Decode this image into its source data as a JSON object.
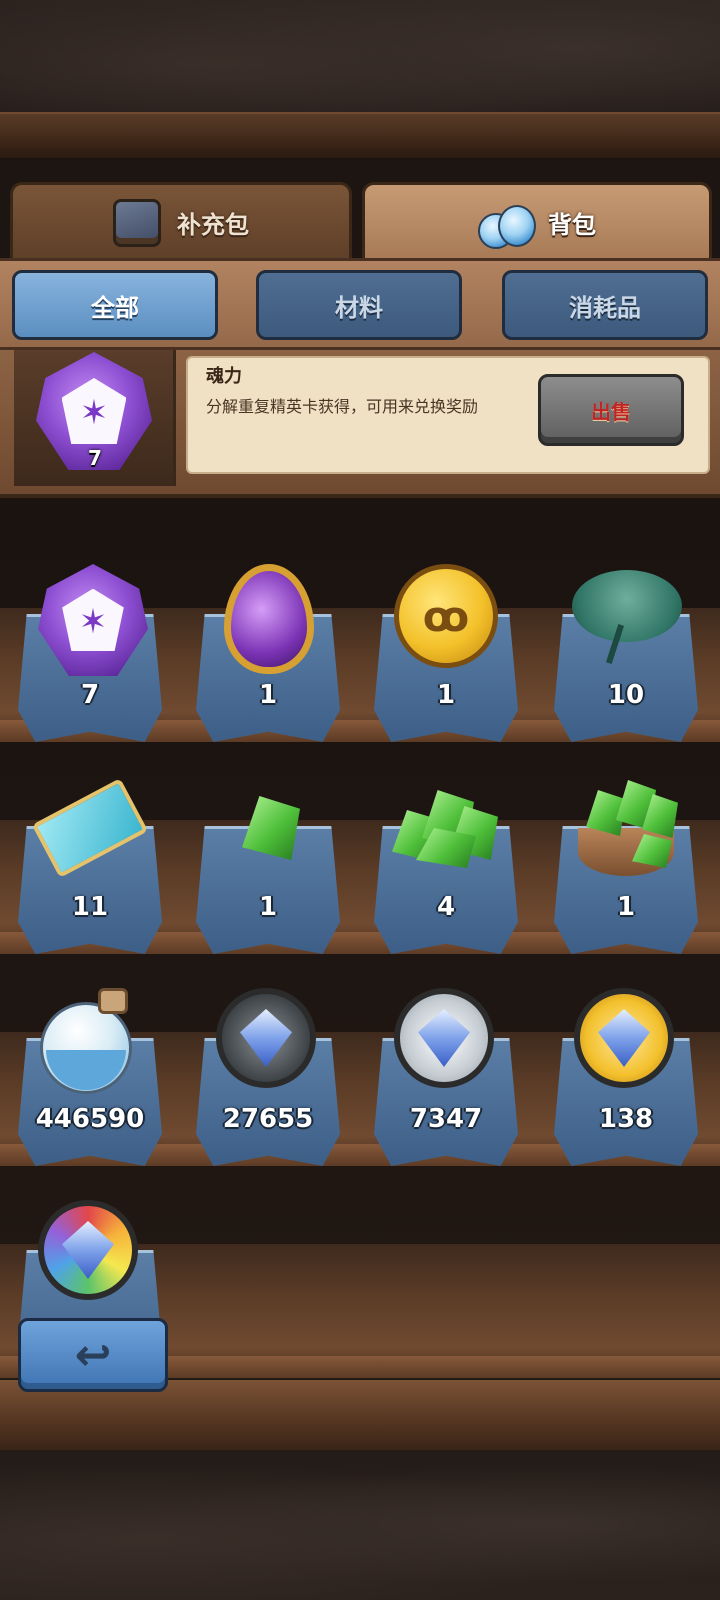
{
  "main_tabs": [
    {
      "label": "补充包",
      "icon": "card-pack-icon",
      "active": false
    },
    {
      "label": "背包",
      "icon": "potion-bottles-icon",
      "active": true
    }
  ],
  "sub_tabs": [
    {
      "label": "全部",
      "active": true
    },
    {
      "label": "材料",
      "active": false
    },
    {
      "label": "消耗品",
      "active": false
    }
  ],
  "detail": {
    "name": "魂力",
    "description": "分解重复精英卡获得，可用来兑换奖励",
    "count": "7",
    "icon": "purple-soul-gem-icon",
    "sell_label": "出售",
    "sell_color": "#c02525"
  },
  "items": [
    {
      "icon": "purple-soul-gem-icon",
      "count": "7"
    },
    {
      "icon": "purple-egg-icon",
      "count": "1"
    },
    {
      "icon": "gold-owl-coin-icon",
      "count": "1"
    },
    {
      "icon": "lotus-leaf-icon",
      "count": "10"
    },
    {
      "icon": "magic-scroll-icon",
      "count": "11"
    },
    {
      "icon": "green-crystal-icon",
      "count": "1"
    },
    {
      "icon": "green-crystal-pile-icon",
      "count": "4"
    },
    {
      "icon": "crystal-sack-icon",
      "count": "1"
    },
    {
      "icon": "dust-bottle-icon",
      "count": "446590"
    },
    {
      "icon": "black-diamond-medal-icon",
      "count": "27655"
    },
    {
      "icon": "silver-diamond-medal-icon",
      "count": "7347"
    },
    {
      "icon": "gold-diamond-medal-icon",
      "count": "138"
    },
    {
      "icon": "rainbow-diamond-medal-icon",
      "count": ""
    }
  ],
  "back_button": {
    "icon": "back-arrow-icon"
  },
  "colors": {
    "active_tab": "#5b8ec0",
    "inactive_tab": "#3d5a7d",
    "slot_cloth": "#4a6c94"
  }
}
